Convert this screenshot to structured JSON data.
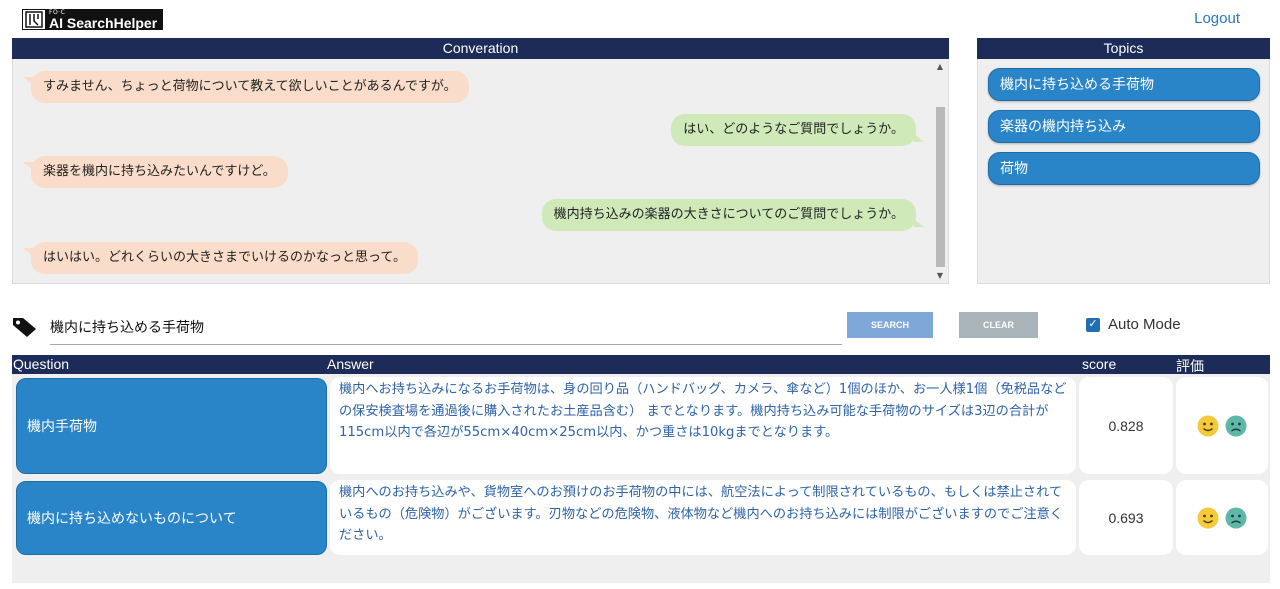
{
  "header": {
    "logo_small": "FO‧C",
    "logo_text": "AI SearchHelper",
    "logout_label": "Logout"
  },
  "conversation": {
    "title": "Converation",
    "messages": [
      {
        "role": "user",
        "text": "すみません、ちょっと荷物について教えて欲しいことがあるんですが。"
      },
      {
        "role": "bot",
        "text": "はい、どのようなご質問でしょうか。"
      },
      {
        "role": "user",
        "text": "楽器を機内に持ち込みたいんですけど。"
      },
      {
        "role": "bot",
        "text": "機内持ち込みの楽器の大きさについてのご質問でしょうか。"
      },
      {
        "role": "user",
        "text": "はいはい。どれくらいの大きさまでいけるのかなっと思って。"
      }
    ]
  },
  "topics": {
    "title": "Topics",
    "items": [
      {
        "label": "機内に持ち込める手荷物"
      },
      {
        "label": "楽器の機内持ち込み"
      },
      {
        "label": "荷物"
      }
    ]
  },
  "search": {
    "value": "機内に持ち込める手荷物",
    "search_label": "SEARCH",
    "clear_label": "CLEAR",
    "auto_mode_label": "Auto Mode",
    "auto_mode_checked": true
  },
  "results": {
    "headers": {
      "question": "Question",
      "answer": "Answer",
      "score": "score",
      "rating": "評価"
    },
    "rows": [
      {
        "question": "機内手荷物",
        "answer": "機内へお持ち込みになるお手荷物は、身の回り品（ハンドバッグ、カメラ、傘など）1個のほか、お一人様1個（免税品などの保安検査場を通過後に購入されたお土産品含む） までとなります。機内持ち込み可能な手荷物のサイズは3辺の合計が115cm以内で各辺が55cm×40cm×25cm以内、かつ重さは10kgまでとなります。",
        "score": "0.828"
      },
      {
        "question": "機内に持ち込めないものについて",
        "answer": "機内へのお持ち込みや、貨物室へのお預けのお手荷物の中には、航空法によって制限されているもの、もしくは禁止されているもの（危険物）がございます。刃物などの危険物、液体物など機内へのお持ち込みには制限がございますのでご注意ください。",
        "score": "0.693"
      }
    ]
  },
  "colors": {
    "navy": "#1c2b57",
    "topic_blue": "#2a85c8",
    "user_bubble": "#f9dcc9",
    "bot_bubble": "#cfe9b9",
    "answer_text": "#2f63a8",
    "link": "#2a78c8"
  },
  "icons": {
    "tag": "tag-icon",
    "good": "smile-face-icon",
    "bad": "frown-face-icon",
    "check": "checkbox-checked-icon"
  }
}
